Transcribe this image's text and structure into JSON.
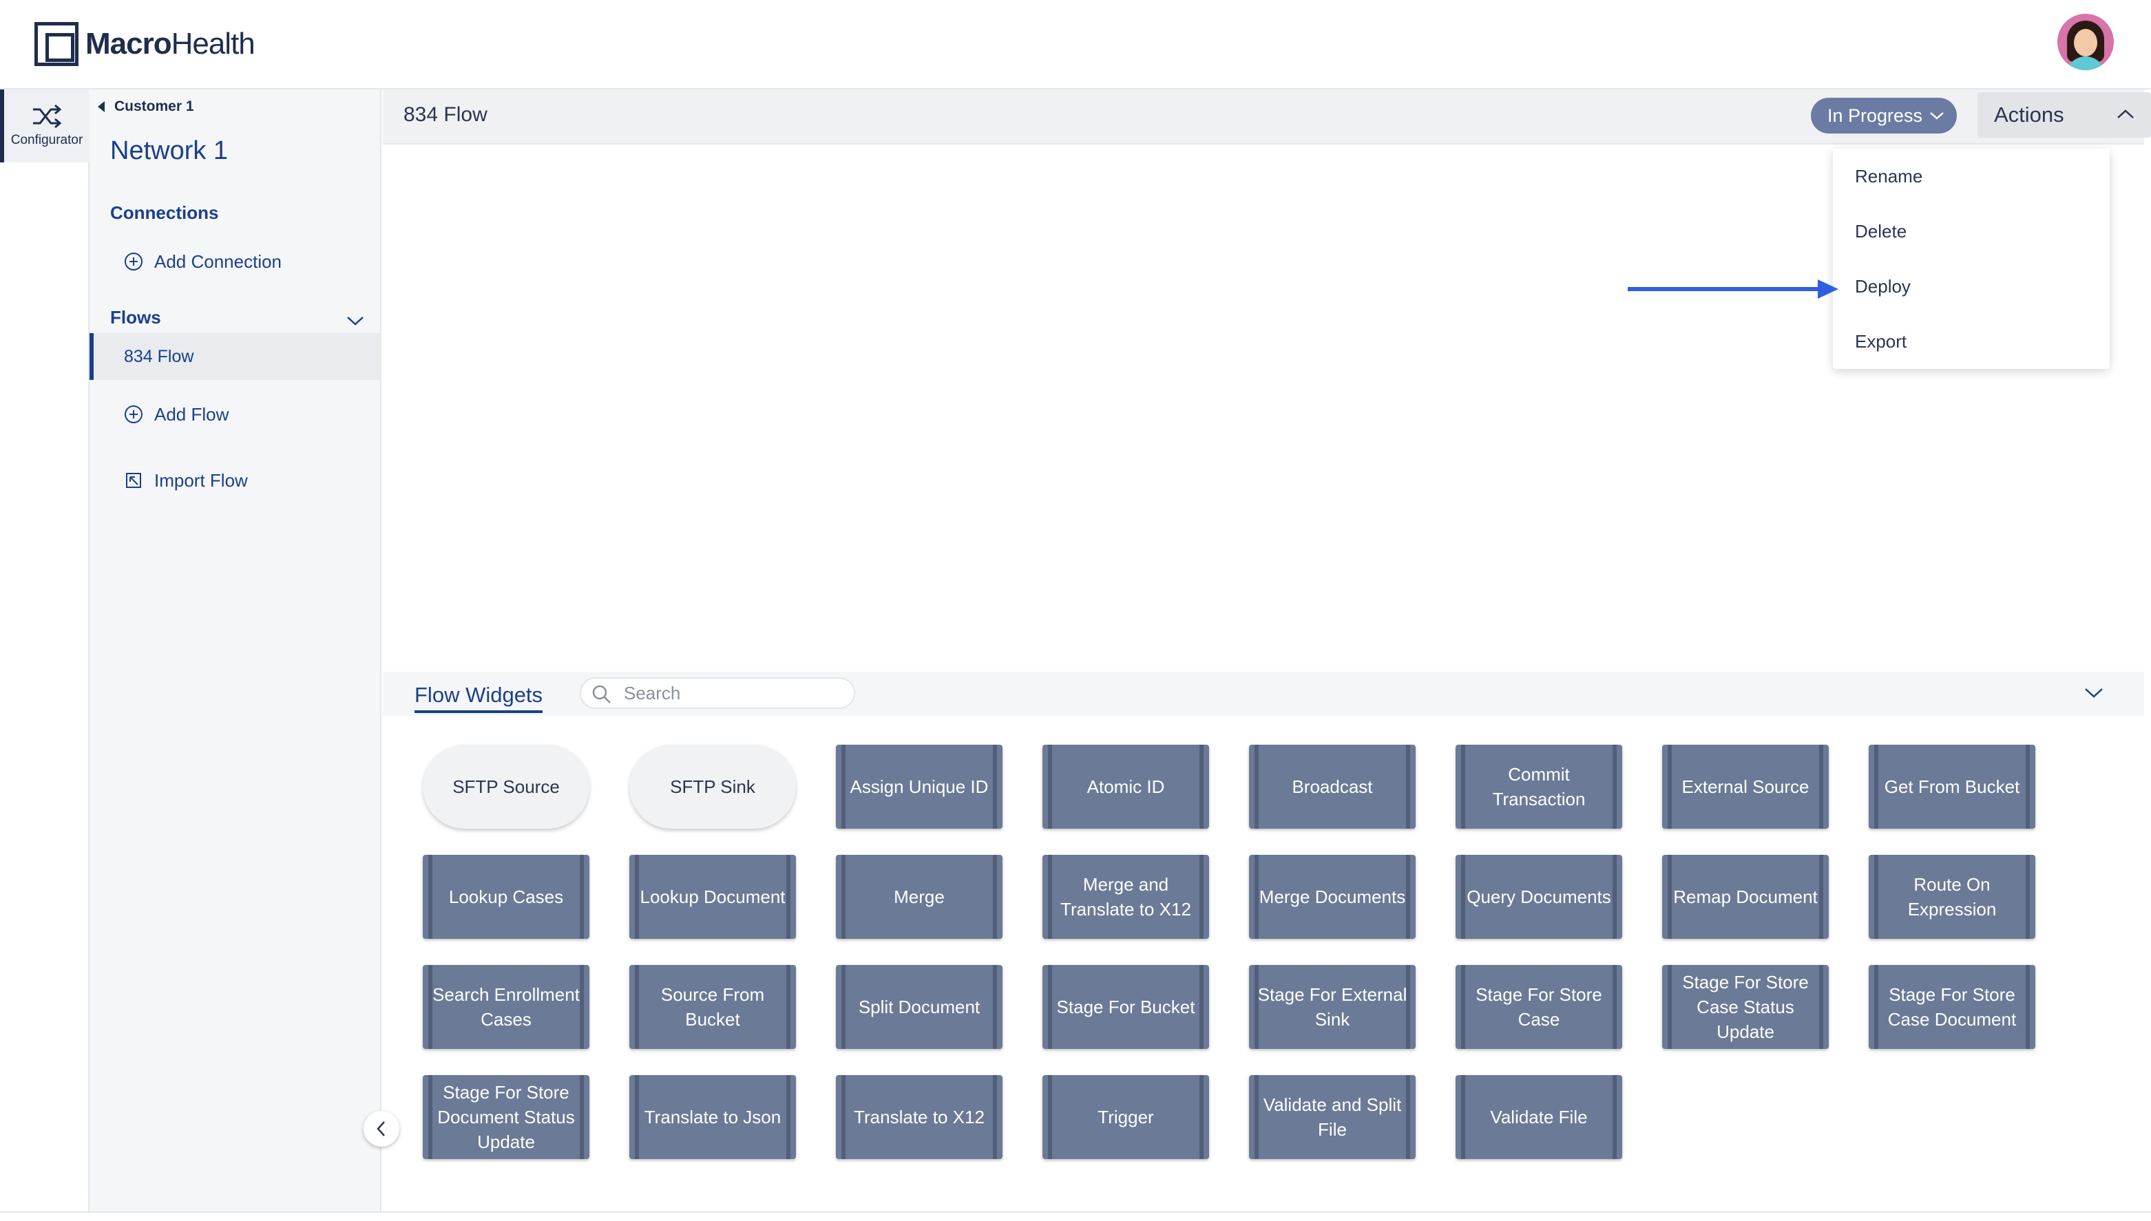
{
  "header": {
    "brand_macro": "Macro",
    "brand_health": "Health"
  },
  "rail": {
    "configurator_label": "Configurator",
    "icon": "shuffle-icon"
  },
  "sidebar": {
    "breadcrumb": "Customer 1",
    "network_title": "Network 1",
    "connections_heading": "Connections",
    "add_connection": "Add Connection",
    "flows_heading": "Flows",
    "flows": [
      "834 Flow"
    ],
    "add_flow": "Add Flow",
    "import_flow": "Import Flow"
  },
  "topbar": {
    "flow_name": "834 Flow",
    "status": "In Progress",
    "actions_label": "Actions"
  },
  "actions_menu": {
    "items": [
      "Rename",
      "Delete",
      "Deploy",
      "Export"
    ],
    "highlighted": "Deploy",
    "arrow_color": "#2f5fe0"
  },
  "widgets": {
    "tab_label": "Flow Widgets",
    "search_placeholder": "Search",
    "items": [
      {
        "label": "SFTP Source",
        "kind": "io"
      },
      {
        "label": "SFTP Sink",
        "kind": "io"
      },
      {
        "label": "Assign Unique ID",
        "kind": "op"
      },
      {
        "label": "Atomic ID",
        "kind": "op"
      },
      {
        "label": "Broadcast",
        "kind": "op"
      },
      {
        "label": "Commit Transaction",
        "kind": "op"
      },
      {
        "label": "External Source",
        "kind": "op"
      },
      {
        "label": "Get From Bucket",
        "kind": "op"
      },
      {
        "label": "Lookup Cases",
        "kind": "op"
      },
      {
        "label": "Lookup Document",
        "kind": "op"
      },
      {
        "label": "Merge",
        "kind": "op"
      },
      {
        "label": "Merge and Translate to X12",
        "kind": "op"
      },
      {
        "label": "Merge Documents",
        "kind": "op"
      },
      {
        "label": "Query Documents",
        "kind": "op"
      },
      {
        "label": "Remap Document",
        "kind": "op"
      },
      {
        "label": "Route On Expression",
        "kind": "op"
      },
      {
        "label": "Search Enrollment Cases",
        "kind": "op"
      },
      {
        "label": "Source From Bucket",
        "kind": "op"
      },
      {
        "label": "Split Document",
        "kind": "op"
      },
      {
        "label": "Stage For Bucket",
        "kind": "op"
      },
      {
        "label": "Stage For External Sink",
        "kind": "op"
      },
      {
        "label": "Stage For Store Case",
        "kind": "op"
      },
      {
        "label": "Stage For Store Case Status Update",
        "kind": "op"
      },
      {
        "label": "Stage For Store Case Document",
        "kind": "op"
      },
      {
        "label": "Stage For Store Document Status Update",
        "kind": "op"
      },
      {
        "label": "Translate to Json",
        "kind": "op"
      },
      {
        "label": "Translate to X12",
        "kind": "op"
      },
      {
        "label": "Trigger",
        "kind": "op"
      },
      {
        "label": "Validate and Split File",
        "kind": "op"
      },
      {
        "label": "Validate File",
        "kind": "op"
      }
    ]
  },
  "colors": {
    "brand_navy": "#1f2d4d",
    "link_blue": "#1a3f8c",
    "widget_fill": "#6b7a96",
    "status_pill": "#6b7ba3"
  }
}
